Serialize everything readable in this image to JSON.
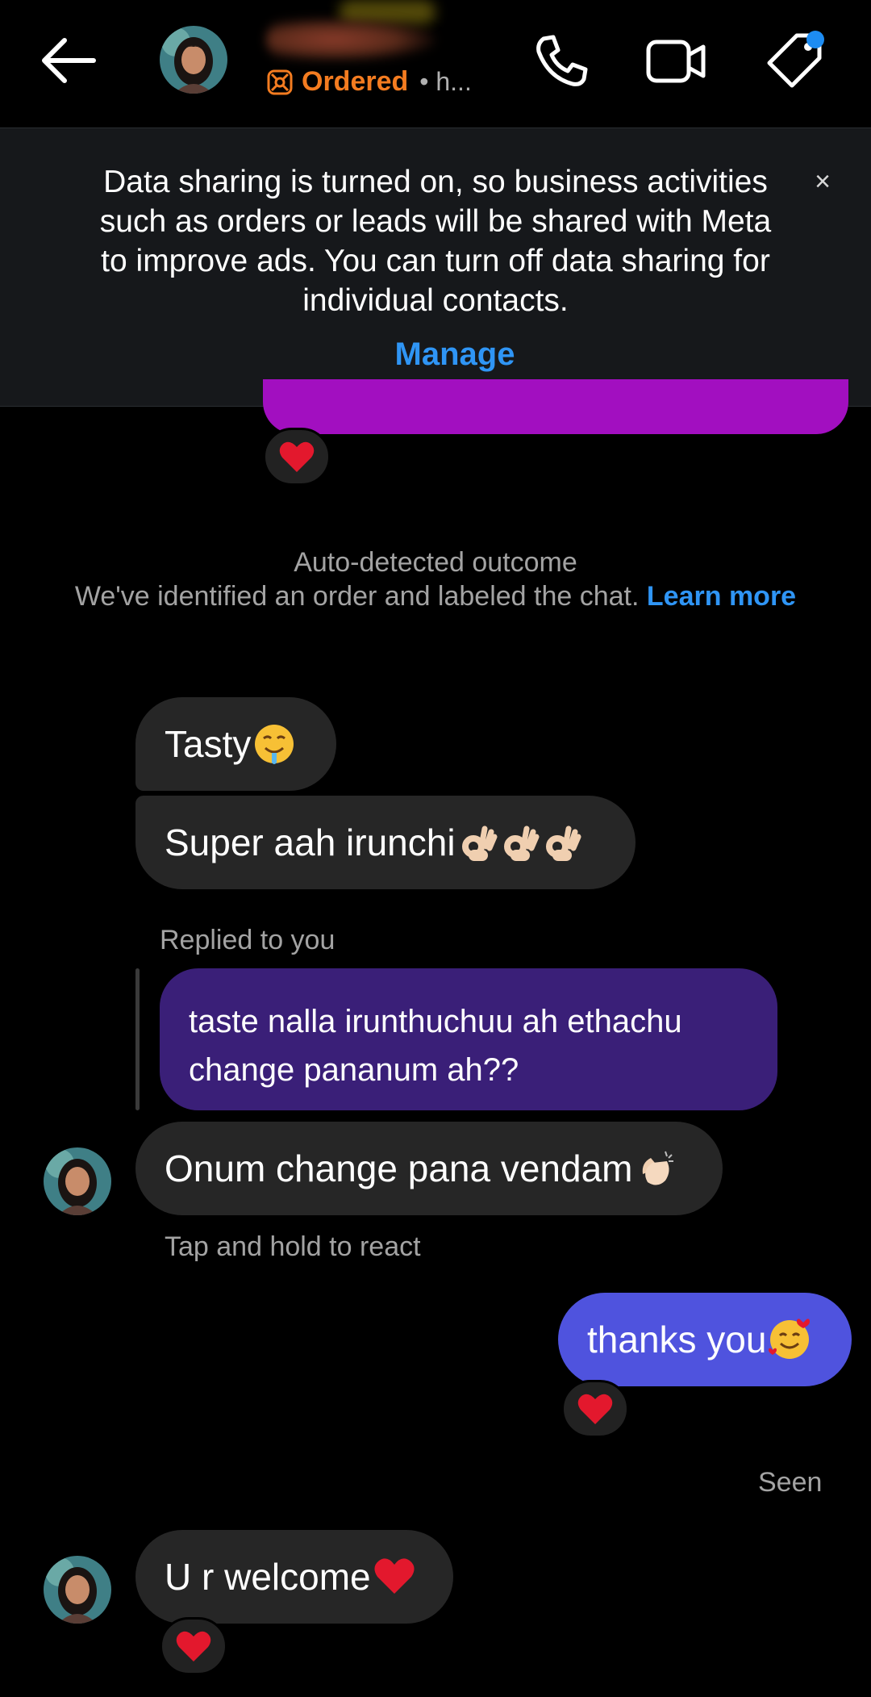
{
  "header": {
    "status_label": "Ordered",
    "status_extra": "• h...",
    "icons": [
      "back-arrow-icon",
      "phone-icon",
      "video-icon",
      "tag-icon"
    ]
  },
  "banner": {
    "text": "Data sharing is turned on, so business activities such as orders or leads will be shared with Meta to improve ads. You can turn off data sharing for individual contacts.",
    "close_label": "×",
    "manage_label": "Manage"
  },
  "system_notice": {
    "title": "Auto-detected outcome",
    "body": "We've identified an order and labeled the chat.",
    "link": "Learn more"
  },
  "messages": {
    "tasty": "Tasty",
    "super": "Super aah irunchi",
    "replied_label": "Replied to you",
    "reply_quote": "taste nalla irunthuchuu ah ethachu change pananum ah??",
    "onum": "Onum change pana vendam",
    "tap_hint": "Tap and hold to react",
    "thanks": "thanks you",
    "seen": "Seen",
    "welcome": "U r welcome"
  },
  "colors": {
    "accent_link": "#2f95f5",
    "ordered": "#f47c20",
    "outgoing_bubble": "#4f53de",
    "incoming_bubble": "#262626",
    "quoted_bubble": "#3a1f78",
    "previous_bubble": "#a20fc0"
  }
}
